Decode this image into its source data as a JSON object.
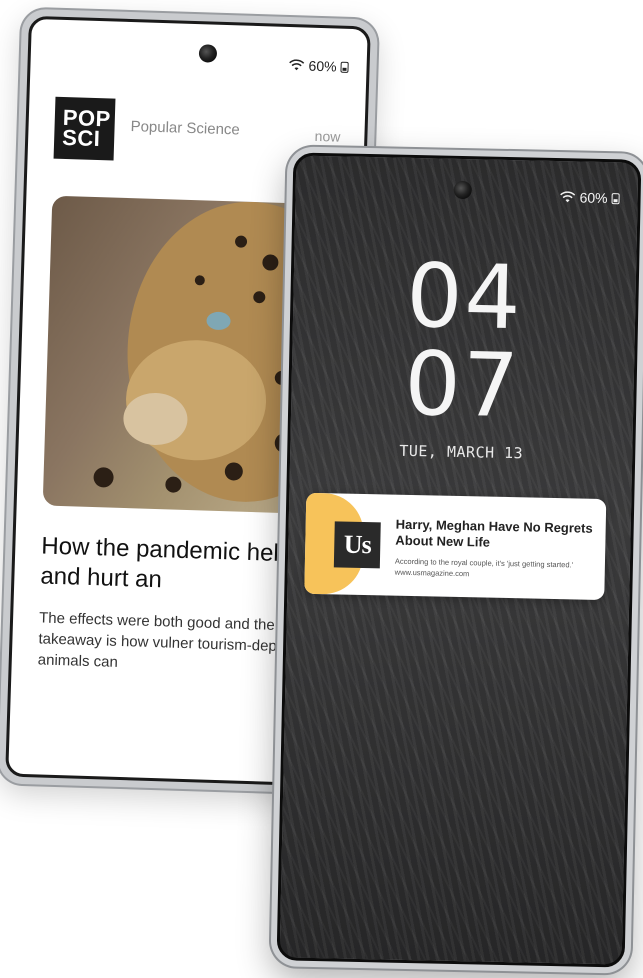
{
  "back_phone": {
    "status": {
      "battery": "60%"
    },
    "notification": {
      "logo_text_line1": "POP",
      "logo_text_line2": "SCI",
      "source": "Popular Science",
      "time": "now"
    },
    "article": {
      "title": "How the pandemic helped and hurt an",
      "description": "The effects were both good and the main takeaway is how vulner tourism-dependent animals can"
    }
  },
  "front_phone": {
    "status": {
      "battery": "60%"
    },
    "clock": {
      "hour": "04",
      "minute": "07"
    },
    "date": "TUE, MARCH 13",
    "notification": {
      "logo_text": "Us",
      "headline": "Harry, Meghan Have No Regrets About New Life",
      "body": "According to the royal couple, it's 'just getting started.'",
      "url": "www.usmagazine.com",
      "accent_color": "#f7c35a"
    }
  },
  "icons": [
    "wifi-icon",
    "battery-icon",
    "camera-icon"
  ]
}
